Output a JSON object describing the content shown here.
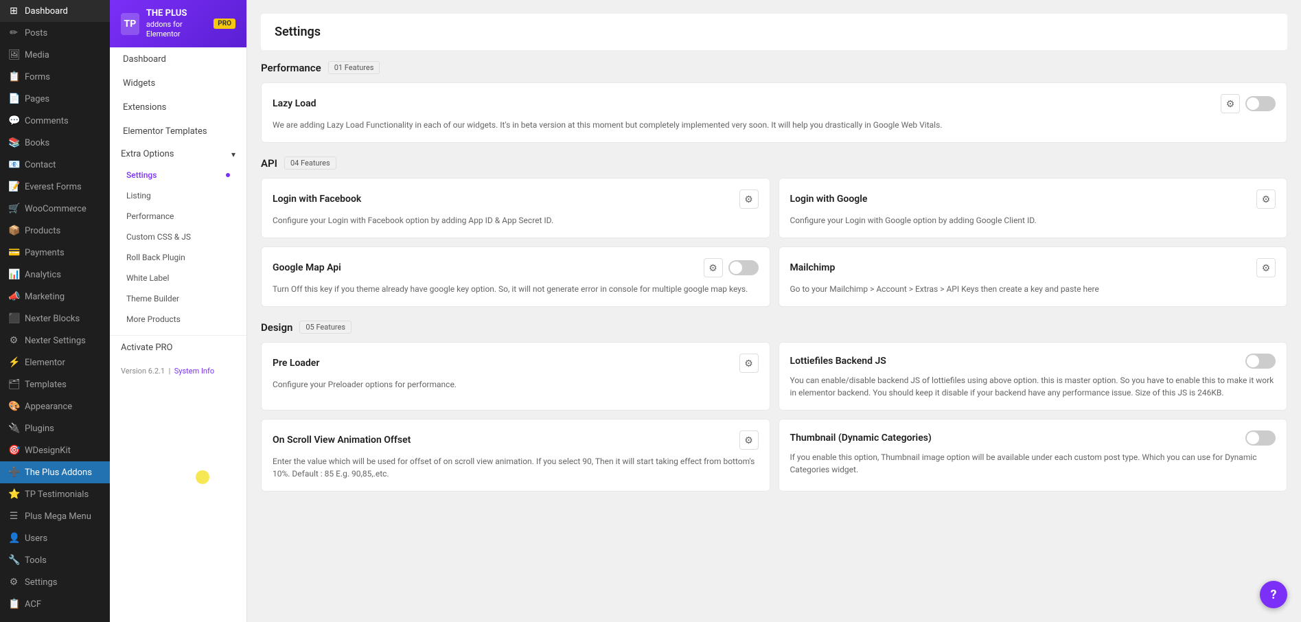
{
  "wp_sidebar": {
    "items": [
      {
        "id": "dashboard",
        "label": "Dashboard",
        "icon": "⊞",
        "active": false
      },
      {
        "id": "posts",
        "label": "Posts",
        "icon": "✏",
        "active": false
      },
      {
        "id": "media",
        "label": "Media",
        "icon": "🖼",
        "active": false
      },
      {
        "id": "forms",
        "label": "Forms",
        "icon": "📋",
        "active": false
      },
      {
        "id": "pages",
        "label": "Pages",
        "icon": "📄",
        "active": false
      },
      {
        "id": "comments",
        "label": "Comments",
        "icon": "💬",
        "active": false
      },
      {
        "id": "books",
        "label": "Books",
        "icon": "📚",
        "active": false
      },
      {
        "id": "contact",
        "label": "Contact",
        "icon": "📧",
        "active": false
      },
      {
        "id": "everest-forms",
        "label": "Everest Forms",
        "icon": "📝",
        "active": false
      },
      {
        "id": "woocommerce",
        "label": "WooCommerce",
        "icon": "🛒",
        "active": false
      },
      {
        "id": "products",
        "label": "Products",
        "icon": "📦",
        "active": false
      },
      {
        "id": "payments",
        "label": "Payments",
        "icon": "💳",
        "active": false
      },
      {
        "id": "analytics",
        "label": "Analytics",
        "icon": "📊",
        "active": false
      },
      {
        "id": "marketing",
        "label": "Marketing",
        "icon": "📣",
        "active": false
      },
      {
        "id": "nexter-blocks",
        "label": "Nexter Blocks",
        "icon": "⬛",
        "active": false
      },
      {
        "id": "nexter-settings",
        "label": "Nexter Settings",
        "icon": "⚙",
        "active": false
      },
      {
        "id": "elementor",
        "label": "Elementor",
        "icon": "⚡",
        "active": false
      },
      {
        "id": "templates",
        "label": "Templates",
        "icon": "🗂",
        "active": false
      },
      {
        "id": "appearance",
        "label": "Appearance",
        "icon": "🎨",
        "active": false
      },
      {
        "id": "plugins",
        "label": "Plugins",
        "icon": "🔌",
        "active": false
      },
      {
        "id": "wdesignkit",
        "label": "WDesignKit",
        "icon": "🎯",
        "active": false
      },
      {
        "id": "theplus-addons",
        "label": "The Plus Addons",
        "icon": "➕",
        "active": true
      },
      {
        "id": "tp-testimonials",
        "label": "TP Testimonials",
        "icon": "⭐",
        "active": false
      },
      {
        "id": "plus-mega-menu",
        "label": "Plus Mega Menu",
        "icon": "☰",
        "active": false
      },
      {
        "id": "users",
        "label": "Users",
        "icon": "👤",
        "active": false
      },
      {
        "id": "tools",
        "label": "Tools",
        "icon": "🔧",
        "active": false
      },
      {
        "id": "settings",
        "label": "Settings",
        "icon": "⚙",
        "active": false
      },
      {
        "id": "acf",
        "label": "ACF",
        "icon": "📋",
        "active": false
      }
    ]
  },
  "theplus_sidebar": {
    "logo": {
      "icon": "TP",
      "name": "THE PLUS",
      "subtitle": "addons for Elementor",
      "pro_label": "PRO"
    },
    "nav_items": [
      {
        "id": "dashboard",
        "label": "Dashboard",
        "active": false
      },
      {
        "id": "widgets",
        "label": "Widgets",
        "active": false
      },
      {
        "id": "extensions",
        "label": "Extensions",
        "active": false
      },
      {
        "id": "elementor-templates",
        "label": "Elementor Templates",
        "active": false
      }
    ],
    "extra_options": {
      "label": "Extra Options",
      "expanded": true,
      "subitems": [
        {
          "id": "settings",
          "label": "Settings",
          "active": true
        },
        {
          "id": "listing",
          "label": "Listing",
          "active": false
        },
        {
          "id": "performance",
          "label": "Performance",
          "active": false
        },
        {
          "id": "custom-css-js",
          "label": "Custom CSS & JS",
          "active": false
        },
        {
          "id": "rollback-plugin",
          "label": "Roll Back Plugin",
          "active": false
        },
        {
          "id": "white-label",
          "label": "White Label",
          "active": false
        },
        {
          "id": "theme-builder",
          "label": "Theme Builder",
          "active": false
        },
        {
          "id": "more-products",
          "label": "More Products",
          "active": false
        }
      ]
    },
    "bottom": {
      "activate_pro": "Activate PRO",
      "version": "Version 6.2.1",
      "system_info": "System Info"
    }
  },
  "main": {
    "page_title": "Settings",
    "sections": [
      {
        "id": "performance",
        "title": "Performance",
        "features_count": "01 Features",
        "cards": [
          {
            "id": "lazy-load",
            "title": "Lazy Load",
            "description": "We are adding Lazy Load Functionality in each of our widgets. It's in beta version at this moment but completely implemented very soon. It will help you drastically in Google Web Vitals.",
            "has_toggle": true,
            "toggle_on": false,
            "has_gear": true,
            "full_width": true
          }
        ]
      },
      {
        "id": "api",
        "title": "API",
        "features_count": "04 Features",
        "cards": [
          {
            "id": "login-facebook",
            "title": "Login with Facebook",
            "description": "Configure your Login with Facebook option by adding App ID & App Secret ID.",
            "has_toggle": false,
            "toggle_on": false,
            "has_gear": true,
            "full_width": false
          },
          {
            "id": "login-google",
            "title": "Login with Google",
            "description": "Configure your Login with Google option by adding Google Client ID.",
            "has_toggle": false,
            "toggle_on": false,
            "has_gear": true,
            "full_width": false
          },
          {
            "id": "google-map-api",
            "title": "Google Map Api",
            "description": "Turn Off this key if you theme already have google key option. So, it will not generate error in console for multiple google map keys.",
            "has_toggle": true,
            "toggle_on": false,
            "has_gear": true,
            "full_width": false
          },
          {
            "id": "mailchimp",
            "title": "Mailchimp",
            "description": "Go to your Mailchimp > Account > Extras > API Keys then create a key and paste here",
            "has_toggle": false,
            "toggle_on": false,
            "has_gear": true,
            "full_width": false
          }
        ]
      },
      {
        "id": "design",
        "title": "Design",
        "features_count": "05 Features",
        "cards": [
          {
            "id": "pre-loader",
            "title": "Pre Loader",
            "description": "Configure your Preloader options for performance.",
            "has_toggle": false,
            "toggle_on": false,
            "has_gear": true,
            "full_width": false
          },
          {
            "id": "lottiefiles-backend-js",
            "title": "Lottiefiles Backend JS",
            "description": "You can enable/disable backend JS of lottiefiles using above option. this is master option. So you have to enable this to make it work in elementor backend. You should keep it disable if your backend have any performance issue. Size of this JS is 246KB.",
            "has_toggle": true,
            "toggle_on": false,
            "has_gear": false,
            "full_width": false
          },
          {
            "id": "on-scroll-view-animation",
            "title": "On Scroll View Animation Offset",
            "description": "Enter the value which will be used for offset of on scroll view animation. If you select 90, Then it will start taking effect from bottom's 10%. Default : 85 E.g. 90,85,.etc.",
            "has_toggle": false,
            "toggle_on": false,
            "has_gear": true,
            "full_width": false
          },
          {
            "id": "thumbnail-dynamic-categories",
            "title": "Thumbnail (Dynamic Categories)",
            "description": "If you enable this option, Thumbnail image option will be available under each custom post type. Which you can use for Dynamic Categories widget.",
            "has_toggle": true,
            "toggle_on": false,
            "has_gear": false,
            "full_width": false
          }
        ]
      }
    ]
  }
}
